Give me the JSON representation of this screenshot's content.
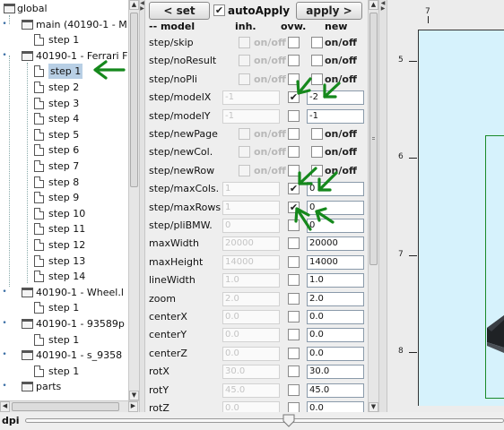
{
  "tree": {
    "items": [
      {
        "label": "global",
        "icon": "folder-icon",
        "expander": "",
        "selected": false
      },
      {
        "label": "main (40190-1 - M",
        "icon": "folder-icon",
        "expander": "⚲",
        "selected": false
      },
      {
        "label": "step 1",
        "icon": "file-icon",
        "expander": "",
        "selected": false
      },
      {
        "label": "40190-1 - Ferrari F",
        "icon": "folder-icon",
        "expander": "⚲",
        "selected": false
      },
      {
        "label": "step 1",
        "icon": "file-icon",
        "expander": "",
        "selected": true
      },
      {
        "label": "step 2",
        "icon": "file-icon",
        "expander": "",
        "selected": false
      },
      {
        "label": "step 3",
        "icon": "file-icon",
        "expander": "",
        "selected": false
      },
      {
        "label": "step 4",
        "icon": "file-icon",
        "expander": "",
        "selected": false
      },
      {
        "label": "step 5",
        "icon": "file-icon",
        "expander": "",
        "selected": false
      },
      {
        "label": "step 6",
        "icon": "file-icon",
        "expander": "",
        "selected": false
      },
      {
        "label": "step 7",
        "icon": "file-icon",
        "expander": "",
        "selected": false
      },
      {
        "label": "step 8",
        "icon": "file-icon",
        "expander": "",
        "selected": false
      },
      {
        "label": "step 9",
        "icon": "file-icon",
        "expander": "",
        "selected": false
      },
      {
        "label": "step 10",
        "icon": "file-icon",
        "expander": "",
        "selected": false
      },
      {
        "label": "step 11",
        "icon": "file-icon",
        "expander": "",
        "selected": false
      },
      {
        "label": "step 12",
        "icon": "file-icon",
        "expander": "",
        "selected": false
      },
      {
        "label": "step 13",
        "icon": "file-icon",
        "expander": "",
        "selected": false
      },
      {
        "label": "step 14",
        "icon": "file-icon",
        "expander": "",
        "selected": false
      },
      {
        "label": "40190-1 - Wheel.l",
        "icon": "folder-icon",
        "expander": "⚲",
        "selected": false
      },
      {
        "label": "step 1",
        "icon": "file-icon",
        "expander": "",
        "selected": false
      },
      {
        "label": "40190-1 - 93589p",
        "icon": "folder-icon",
        "expander": "⚲",
        "selected": false
      },
      {
        "label": "step 1",
        "icon": "file-icon",
        "expander": "",
        "selected": false
      },
      {
        "label": "40190-1 - s_9358",
        "icon": "folder-icon",
        "expander": "⚲",
        "selected": false
      },
      {
        "label": "step 1",
        "icon": "file-icon",
        "expander": "",
        "selected": false
      },
      {
        "label": "parts",
        "icon": "folder-icon",
        "expander": "⚲",
        "selected": false
      }
    ]
  },
  "toolbar": {
    "set_label": "< set",
    "auto_apply_label": "autoApply",
    "auto_apply_checked": "✔",
    "apply_label": "apply >"
  },
  "columns": {
    "model": "-- model",
    "inh": "inh.",
    "ovw": "ovw.",
    "new": "new"
  },
  "properties": [
    {
      "name": "step/skip",
      "type": "bool",
      "inh": "on/off",
      "ovw": false,
      "new": "on/off"
    },
    {
      "name": "step/noResult",
      "type": "bool",
      "inh": "on/off",
      "ovw": false,
      "new": "on/off"
    },
    {
      "name": "step/noPli",
      "type": "bool",
      "inh": "on/off",
      "ovw": false,
      "new": "on/off"
    },
    {
      "name": "step/modelX",
      "type": "value",
      "inh": "-1",
      "ovw": true,
      "new": "-2"
    },
    {
      "name": "step/modelY",
      "type": "value",
      "inh": "-1",
      "ovw": false,
      "new": "-1"
    },
    {
      "name": "step/newPage",
      "type": "bool",
      "inh": "on/off",
      "ovw": false,
      "new": "on/off"
    },
    {
      "name": "step/newCol.",
      "type": "bool",
      "inh": "on/off",
      "ovw": false,
      "new": "on/off"
    },
    {
      "name": "step/newRow",
      "type": "bool",
      "inh": "on/off",
      "ovw": false,
      "new": "on/off"
    },
    {
      "name": "step/maxCols.",
      "type": "value",
      "inh": "1",
      "ovw": true,
      "new": "0"
    },
    {
      "name": "step/maxRows",
      "type": "value",
      "inh": "1",
      "ovw": true,
      "new": "0"
    },
    {
      "name": "step/pliBMW.",
      "type": "value",
      "inh": "0",
      "ovw": false,
      "new": "0"
    },
    {
      "name": "maxWidth",
      "type": "value",
      "inh": "20000",
      "ovw": false,
      "new": "20000"
    },
    {
      "name": "maxHeight",
      "type": "value",
      "inh": "14000",
      "ovw": false,
      "new": "14000"
    },
    {
      "name": "lineWidth",
      "type": "value",
      "inh": "1.0",
      "ovw": false,
      "new": "1.0"
    },
    {
      "name": "zoom",
      "type": "value",
      "inh": "2.0",
      "ovw": false,
      "new": "2.0"
    },
    {
      "name": "centerX",
      "type": "value",
      "inh": "0.0",
      "ovw": false,
      "new": "0.0"
    },
    {
      "name": "centerY",
      "type": "value",
      "inh": "0.0",
      "ovw": false,
      "new": "0.0"
    },
    {
      "name": "centerZ",
      "type": "value",
      "inh": "0.0",
      "ovw": false,
      "new": "0.0"
    },
    {
      "name": "rotX",
      "type": "value",
      "inh": "30.0",
      "ovw": false,
      "new": "30.0"
    },
    {
      "name": "rotY",
      "type": "value",
      "inh": "45.0",
      "ovw": false,
      "new": "45.0"
    },
    {
      "name": "rotZ",
      "type": "value",
      "inh": "0.0",
      "ovw": false,
      "new": "0.0"
    }
  ],
  "view": {
    "ruler_top": "7",
    "ruler_left": [
      "5",
      "6",
      "7",
      "8"
    ],
    "canvas_color": "#d6f2fc",
    "frame_color": "#1a8a2a"
  },
  "dpi": {
    "label": "dpi",
    "value": 0.55
  },
  "colors": {
    "annotation": "#15881c",
    "selection": "#b8cfe5"
  }
}
